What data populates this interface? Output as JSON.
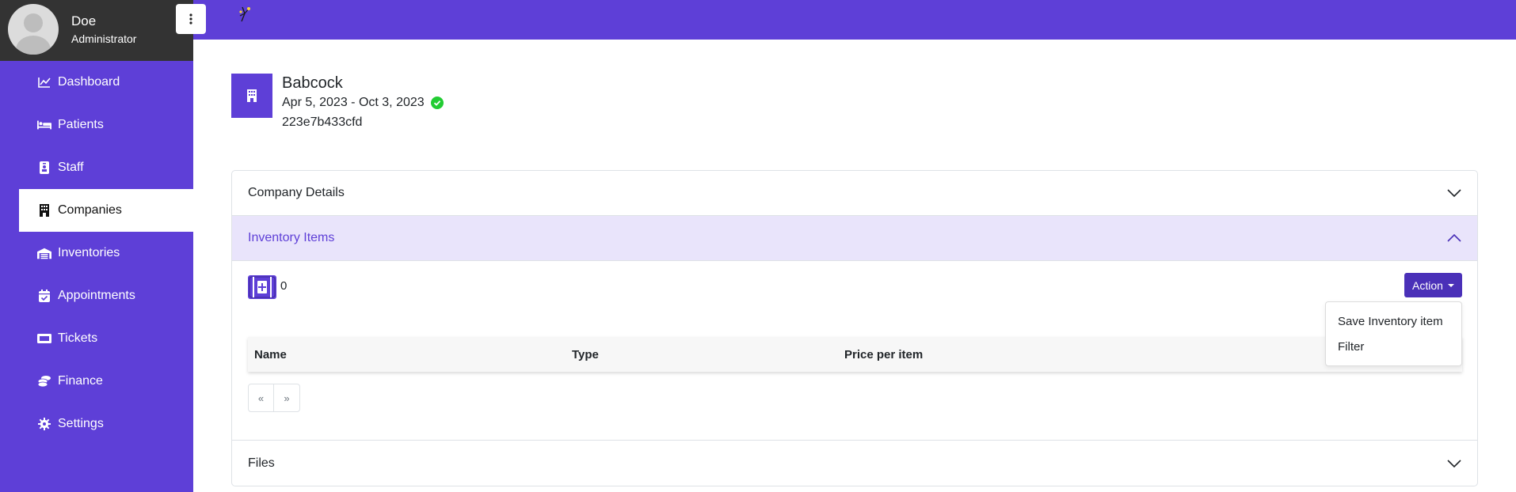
{
  "user": {
    "name": "Doe",
    "role": "Administrator"
  },
  "sidebar": {
    "items": [
      {
        "label": "Dashboard",
        "icon": "chart-line-icon"
      },
      {
        "label": "Patients",
        "icon": "bed-icon"
      },
      {
        "label": "Staff",
        "icon": "id-badge-icon"
      },
      {
        "label": "Companies",
        "icon": "building-icon",
        "active": true
      },
      {
        "label": "Inventories",
        "icon": "warehouse-icon"
      },
      {
        "label": "Appointments",
        "icon": "calendar-check-icon"
      },
      {
        "label": "Tickets",
        "icon": "ticket-icon"
      },
      {
        "label": "Finance",
        "icon": "coins-icon"
      },
      {
        "label": "Settings",
        "icon": "gear-icon"
      }
    ]
  },
  "company": {
    "name": "Babcock",
    "dates": "Apr 5, 2023 - Oct 3, 2023",
    "id": "223e7b433cfd",
    "status_color": "#22cc33"
  },
  "accordion": {
    "company_details": "Company Details",
    "inventory_items": "Inventory Items",
    "files": "Files"
  },
  "inventory": {
    "count": "0",
    "action_label": "Action",
    "menu": [
      "Save Inventory item",
      "Filter"
    ],
    "columns": [
      "Name",
      "Type",
      "Price per item"
    ],
    "pager": {
      "prev": "«",
      "next": "»"
    }
  },
  "colors": {
    "accent": "#5e3fd7",
    "dark_accent": "#4a30b8",
    "user_panel": "#333333"
  }
}
